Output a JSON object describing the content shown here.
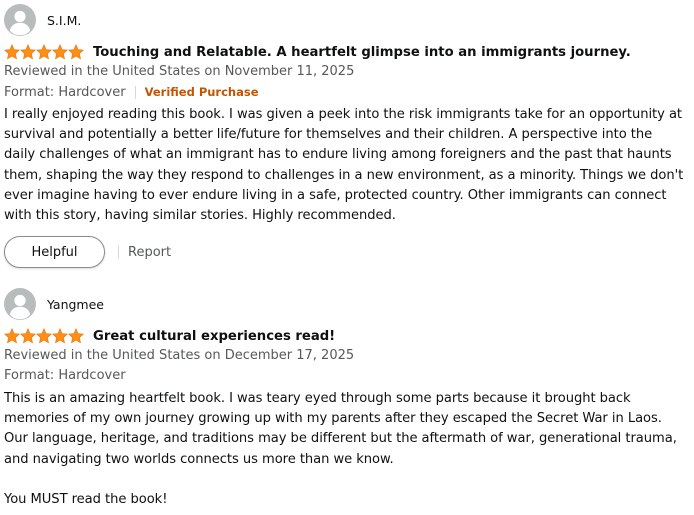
{
  "colors": {
    "star": "#ff8e17",
    "verified": "#c45500",
    "muted": "#565959",
    "text": "#0f1111"
  },
  "reviews": [
    {
      "profile_name": "S.I.M.",
      "rating": 5,
      "title": "Touching and Relatable. A heartfelt glimpse into an immigrants journey.",
      "reviewed_line": "Reviewed in the United States on November 11, 2025",
      "format": "Format: Hardcover",
      "verified": "Verified Purchase",
      "paragraphs": [
        "I really enjoyed reading this book. I was given a peek into the risk immigrants take for an opportunity at survival and potentially a better life/future for themselves and their children. A perspective into the daily challenges of what an immigrant has to endure living among foreigners and the past that haunts them, shaping the way they respond to challenges in a new environment, as a minority. Things we don't ever imagine having to ever endure living in a safe, protected country. Other immigrants can connect with this story, having similar stories. Highly recommended."
      ],
      "helpful_label": "Helpful",
      "report_label": "Report"
    },
    {
      "profile_name": "Yangmee",
      "rating": 5,
      "title": "Great cultural experiences read!",
      "reviewed_line": "Reviewed in the United States on December 17, 2025",
      "format": "Format: Hardcover",
      "paragraphs": [
        "This is an amazing heartfelt book. I was teary eyed through some parts because it brought back memories of my own journey growing up with my parents after they escaped the Secret War in Laos. Our language, heritage, and traditions may be different but the aftermath of war, generational trauma, and navigating two worlds connects us more than we know.",
        "You MUST read the book!"
      ]
    }
  ]
}
